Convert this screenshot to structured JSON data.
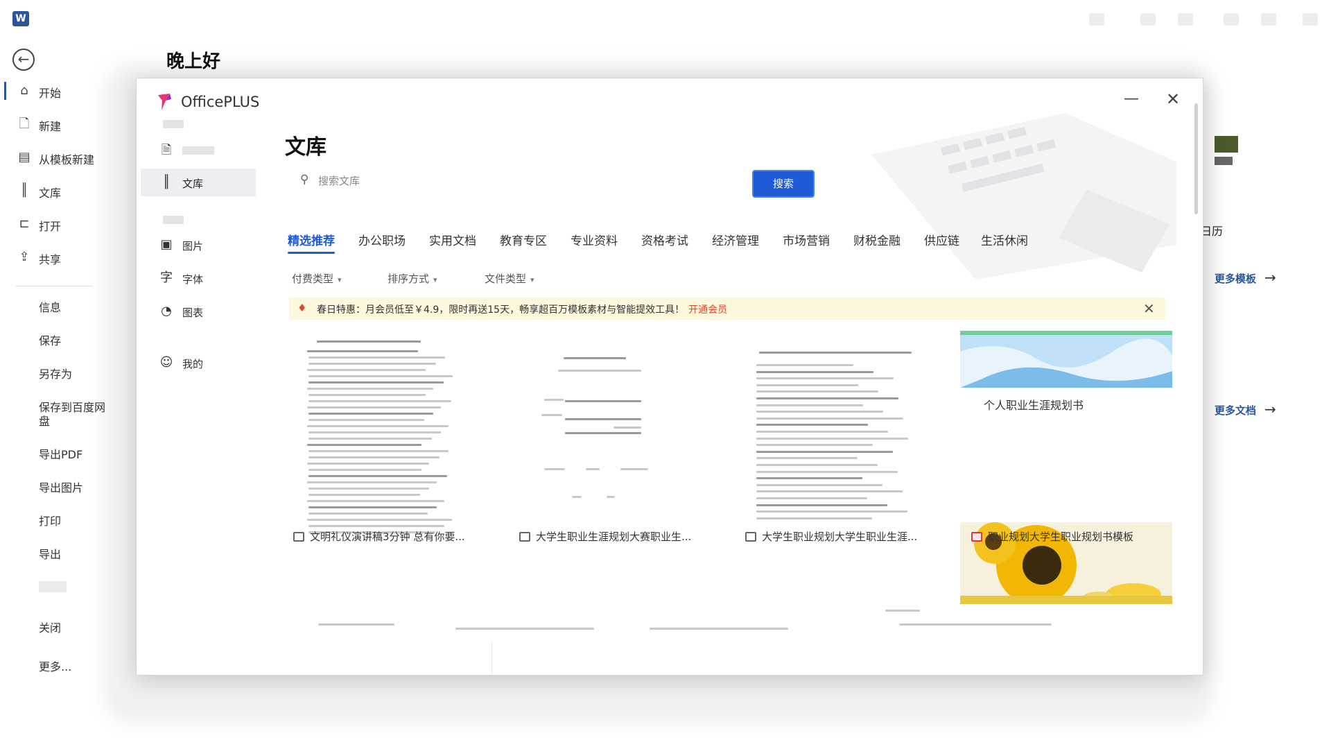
{
  "window": {
    "title": ""
  },
  "nav": {
    "items": [
      {
        "label": "开始",
        "icon": "home-icon"
      },
      {
        "label": "新建",
        "icon": "new-doc-icon"
      },
      {
        "label": "从模板新建",
        "icon": "template-icon"
      },
      {
        "label": "文库",
        "icon": "library-icon"
      },
      {
        "label": "打开",
        "icon": "folder-open-icon"
      },
      {
        "label": "共享",
        "icon": "share-icon"
      }
    ],
    "text_items": [
      "信息",
      "保存",
      "另存为",
      "保存到百度网盘",
      "导出PDF",
      "导出图片",
      "打印",
      "导出",
      "",
      "关闭",
      "更多..."
    ]
  },
  "greeting": "晚上好",
  "background": {
    "calendar_label": "日历",
    "more_templates": "更多模板",
    "more_docs": "更多文档"
  },
  "modal": {
    "brand": "OfficePLUS",
    "sidebar": {
      "section1": "",
      "section2": "",
      "items": [
        {
          "label": "",
          "icon": "document-icon"
        },
        {
          "label": "文库",
          "icon": "library-icon"
        },
        {
          "label": "图片",
          "icon": "image-icon"
        },
        {
          "label": "字体",
          "icon": "font-icon"
        },
        {
          "label": "图表",
          "icon": "chart-icon"
        },
        {
          "label": "我的",
          "icon": "user-icon"
        }
      ]
    },
    "title": "文库",
    "search": {
      "placeholder": "搜索文库",
      "button": "搜索"
    },
    "tabs": [
      "精选推荐",
      "办公职场",
      "实用文档",
      "教育专区",
      "专业资料",
      "资格考试",
      "经济管理",
      "市场营销",
      "财税金融",
      "供应链",
      "生活休闲"
    ],
    "filters": [
      "付费类型",
      "排序方式",
      "文件类型"
    ],
    "promo": {
      "text": "春日特惠：月会员低至￥4.9，限时再送15天，畅享超百万模板素材与智能提效工具！",
      "link": "开通会员"
    },
    "cards": [
      {
        "caption": "文明礼仪演讲稿3分钟 总有你要...",
        "icon": "word-doc-icon"
      },
      {
        "caption": "大学生职业生涯规划大赛职业生...",
        "icon": "word-doc-icon"
      },
      {
        "caption": "大学生职业规划大学生职业生涯...",
        "icon": "word-doc-icon"
      },
      {
        "caption": "职业规划大学生职业规划书模板",
        "icon": "ppt-doc-icon"
      }
    ],
    "template_label": "个人职业生涯规划书",
    "colors": {
      "accent": "#1f5bd6",
      "promo_link": "#e0462e",
      "promo_bg": "#fdf8dc"
    }
  }
}
